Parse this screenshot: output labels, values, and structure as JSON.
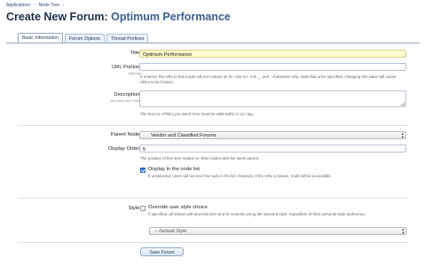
{
  "breadcrumb": {
    "items": [
      "Applications",
      "Node Tree"
    ],
    "separator": "›"
  },
  "page": {
    "title_prefix": "Create New Forum:",
    "title_name": "Optimum Performance"
  },
  "tabs": [
    {
      "label": "Basic Information",
      "active": true
    },
    {
      "label": "Forum Options",
      "active": false
    },
    {
      "label": "Thread Prefixes",
      "active": false
    }
  ],
  "form": {
    "title_label": "Title:",
    "title_value": "Optimum Performance",
    "url_label": "URL Portion:",
    "url_sublabel": "Optional",
    "url_value": "",
    "url_help": "If entered, the URL to this forum will not contain an ID. Use a-z, 0-9, _, and - characters only. Note that once specified, changing this value will cause URLs to be broken.",
    "desc_label": "Description:",
    "desc_sublabel": "You may use HTML",
    "desc_help": "The text (or HTML) you insert here must be valid within a <p> tag.",
    "parent_label": "Parent Node:",
    "parent_value": "Vendor and Classified Forums",
    "order_label": "Display Order:",
    "order_value": "5",
    "order_help": "The position of this item relative to other nodes with the same parent.",
    "display_label": "Display in the node list",
    "display_help": "If unselected, users will not see this node in the list. However, if the URL is known, it will still be accessible.",
    "style_label": "Style:",
    "override_label": "Override user style choice",
    "override_help": "If specified, all visitors will view this item and its contents using the selected style, regardless of their personal style preference.",
    "style_value": "-- Default Style",
    "submit_label": "Save Forum"
  },
  "colors": {
    "accent": "#2b4a7a",
    "title_highlight": "#fffbcc",
    "checkbox_checked": "#2f7bd9"
  }
}
